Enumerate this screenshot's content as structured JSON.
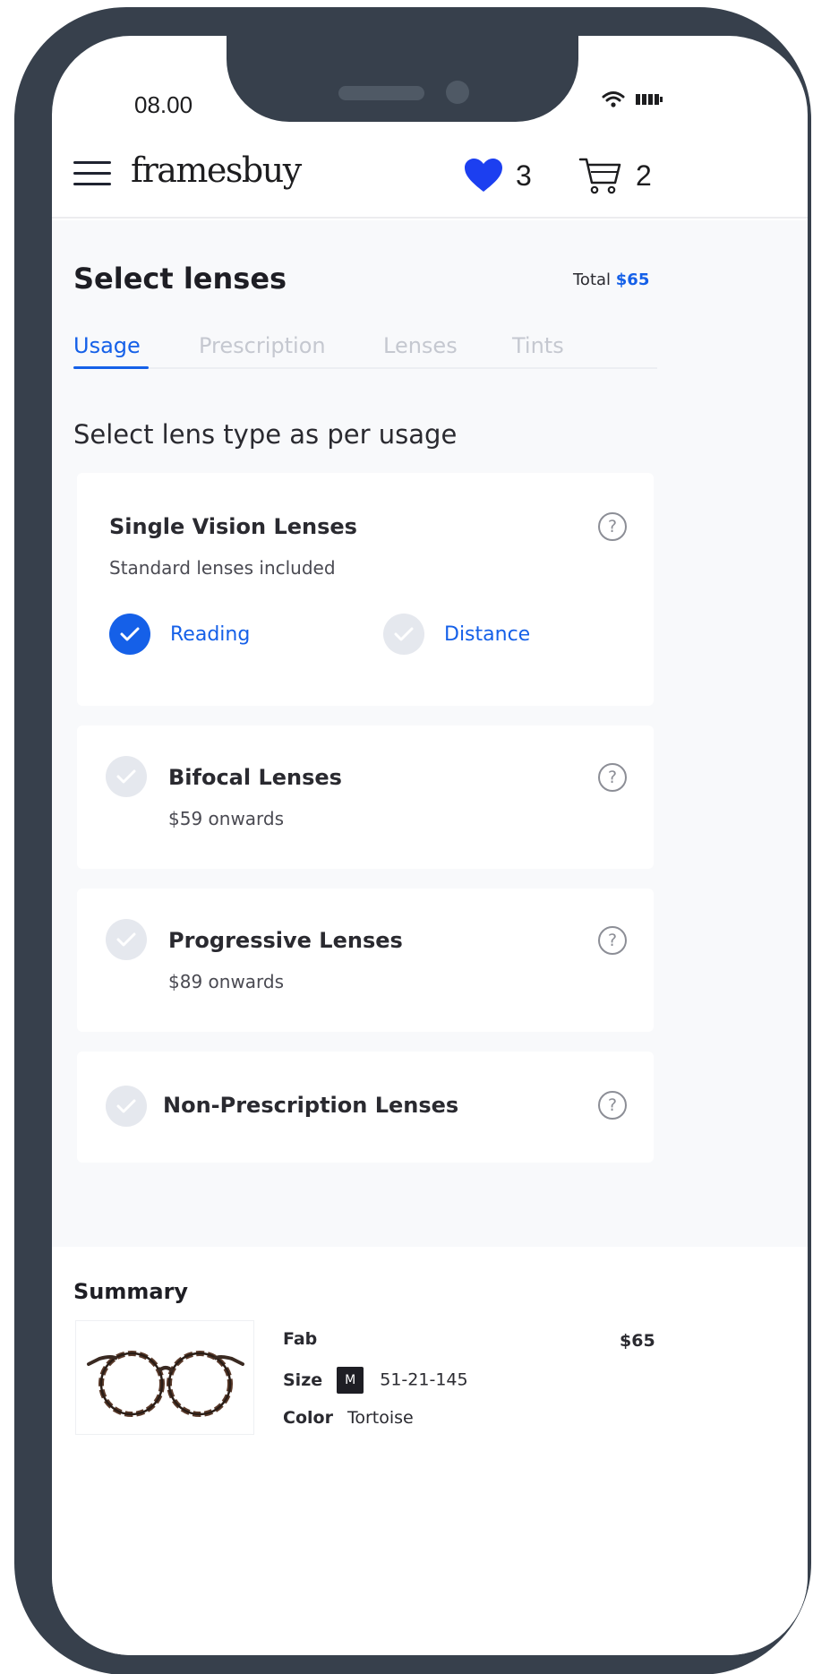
{
  "status_bar": {
    "time": "08.00"
  },
  "header": {
    "logo": "framesbuy",
    "wishlist_count": "3",
    "cart_count": "2"
  },
  "page": {
    "title": "Select lenses",
    "total_label": "Total",
    "total_value": "$65"
  },
  "tabs": [
    "Usage",
    "Prescription",
    "Lenses",
    "Tints"
  ],
  "section_title": "Select lens type as per usage",
  "lens_options": {
    "single_vision": {
      "title": "Single Vision Lenses",
      "subtitle": "Standard lenses included",
      "sub_options": [
        "Reading",
        "Distance"
      ],
      "selected_sub_option": "Reading"
    },
    "bifocal": {
      "title": "Bifocal Lenses",
      "subtitle": "$59 onwards"
    },
    "progressive": {
      "title": "Progressive Lenses",
      "subtitle": "$89 onwards"
    },
    "non_prescription": {
      "title": "Non-Prescription Lenses"
    }
  },
  "help_glyph": "?",
  "summary": {
    "title": "Summary",
    "product_name": "Fab",
    "price": "$65",
    "size_label": "Size",
    "size_badge": "M",
    "size_value": "51-21-145",
    "color_label": "Color",
    "color_value": "Tortoise"
  },
  "colors": {
    "accent": "#1560e8",
    "heart": "#1c3ff0",
    "frame": "#37404c",
    "background": "#f8f9fb"
  }
}
